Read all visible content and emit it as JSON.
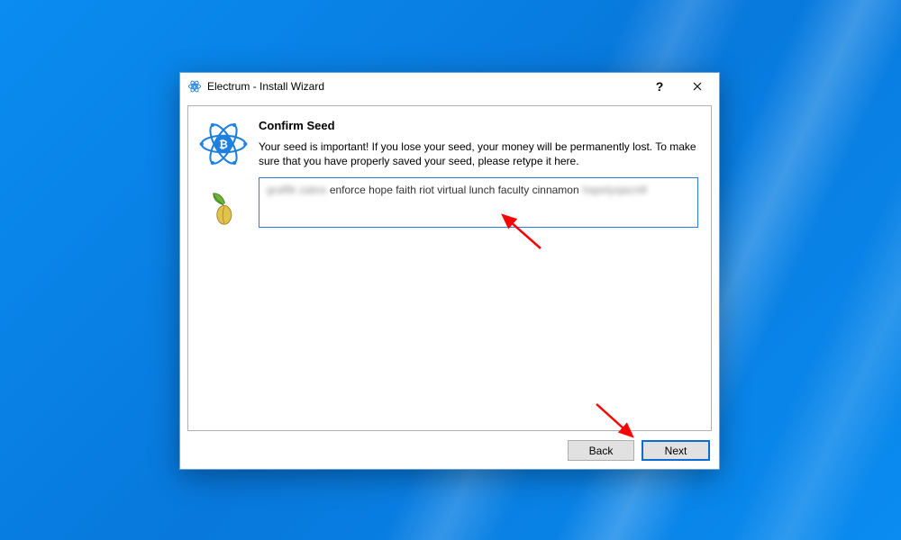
{
  "window": {
    "title": "Electrum  -  Install Wizard"
  },
  "page": {
    "heading": "Confirm Seed",
    "description": "Your seed is important! If you lose your seed, your money will be permanently lost. To make sure that you have properly saved your seed, please retype it here.",
    "seed_blur_left": "graffik zabra",
    "seed_visible": "enforce hope faith riot virtual lunch faculty cinnamon",
    "seed_blur_right": "hapelysjacnill"
  },
  "buttons": {
    "back": "Back",
    "next": "Next"
  }
}
